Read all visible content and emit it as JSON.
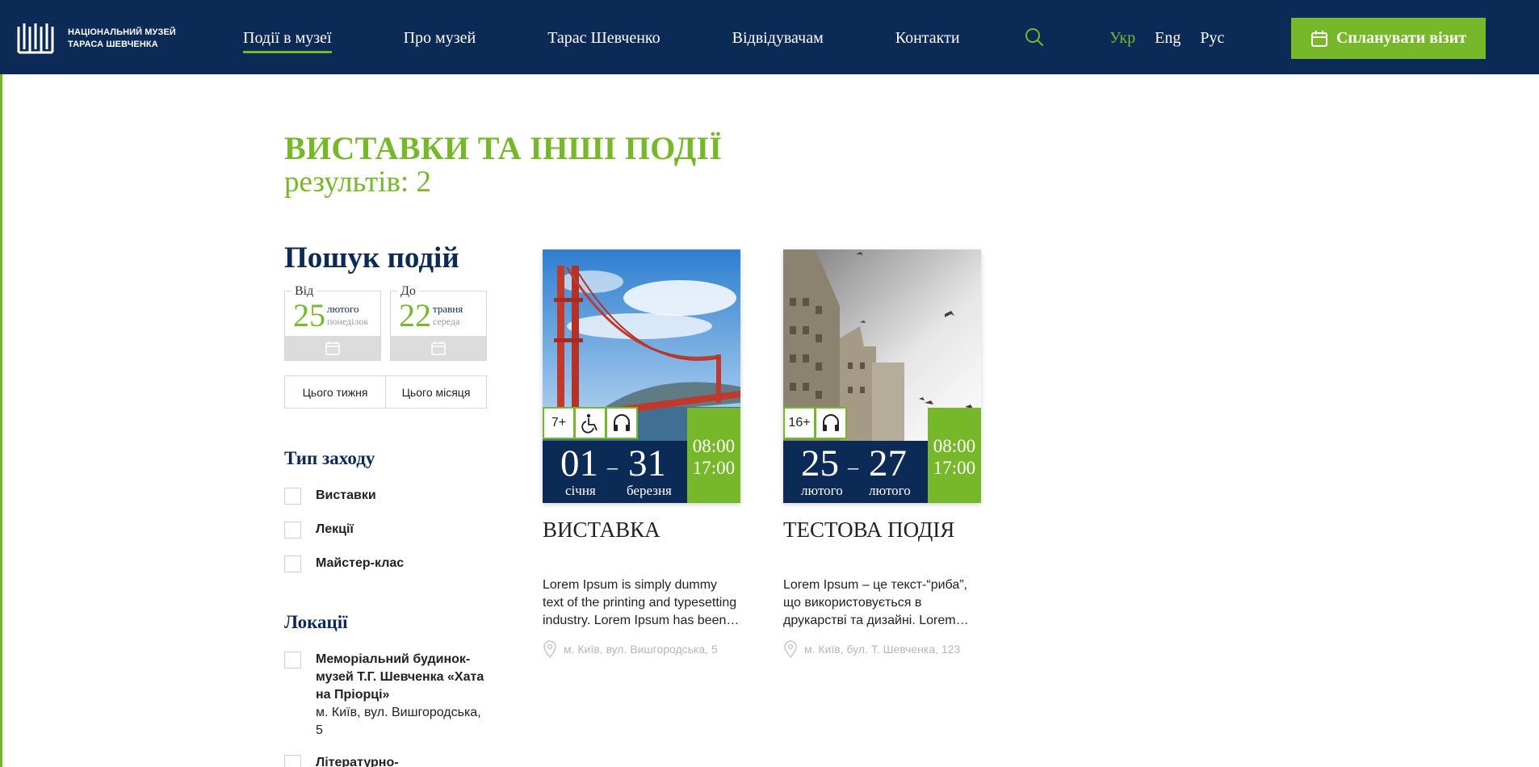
{
  "header": {
    "logo_line1": "НАЦІОНАЛЬНИЙ МУЗЕЙ",
    "logo_line2": "ТАРАСА ШЕВЧЕНКА",
    "nav": [
      {
        "label": "Події в музеї"
      },
      {
        "label": "Про музей"
      },
      {
        "label": "Тарас Шевченко"
      },
      {
        "label": "Відвідувачам"
      },
      {
        "label": "Контакти"
      }
    ],
    "langs": [
      {
        "label": "Укр"
      },
      {
        "label": "Eng"
      },
      {
        "label": "Рус"
      }
    ],
    "plan_label": "Спланувати візит"
  },
  "page": {
    "title": "ВИСТАВКИ ТА ІНШІ ПОДІЇ",
    "results": "результів: 2"
  },
  "sidebar": {
    "search_title": "Пошук подій",
    "from": {
      "legend": "Від",
      "day": "25",
      "month": "лютого",
      "weekday": "понеділок"
    },
    "to": {
      "legend": "До",
      "day": "22",
      "month": "травня",
      "weekday": "середа"
    },
    "quick": [
      {
        "label": "Цього тижня"
      },
      {
        "label": "Цього місяця"
      }
    ],
    "type_title": "Тип заходу",
    "types": [
      {
        "label": "Виставки"
      },
      {
        "label": "Лекції"
      },
      {
        "label": "Майстер-клас"
      }
    ],
    "locations_title": "Локації",
    "locations": [
      {
        "name": "Меморіальний будинок-музей Т.Г. Шевченка «Хата на Пріорці»",
        "address": "м. Київ, вул. Вишгородська, 5"
      },
      {
        "name": "Літературно-",
        "address": ""
      }
    ]
  },
  "events": [
    {
      "age": "7+",
      "start_day": "01",
      "start_month": "січня",
      "end_day": "31",
      "end_month": "березня",
      "time_start": "08:00",
      "time_end": "17:00",
      "title": "ВИСТАВКА",
      "description": "Lorem Ipsum is simply dummy text of the printing and typesetting industry. Lorem Ipsum has been…",
      "location": "м. Київ, вул. Вишгородська, 5"
    },
    {
      "age": "16+",
      "start_day": "25",
      "start_month": "лютого",
      "end_day": "27",
      "end_month": "лютого",
      "time_start": "08:00",
      "time_end": "17:00",
      "title": "ТЕСТОВА ПОДІЯ",
      "description": "Lorem Ipsum – це текст-“риба”, що використовується в друкарстві та дизайні. Lorem…",
      "location": "м. Київ, бул. Т. Шевченка, 123"
    }
  ],
  "colors": {
    "navy": "#0c2a56",
    "green": "#76b82a"
  }
}
